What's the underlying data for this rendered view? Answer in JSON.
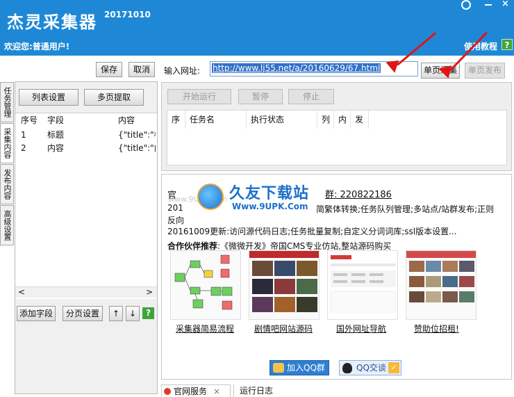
{
  "app": {
    "title": "杰灵采集器",
    "version": "20171010",
    "welcome": "欢迎您:普通用户!",
    "tutorial": "使用教程",
    "help_badge": "?"
  },
  "side_tabs": [
    "任务管理",
    "采集内容",
    "发布内容",
    "高级设置"
  ],
  "toolbar": {
    "save": "保存",
    "cancel": "取消",
    "list_settings": "列表设置",
    "multi_extract": "多页提取"
  },
  "field_table": {
    "headers": [
      "序号",
      "字段",
      "内容"
    ],
    "rows": [
      {
        "no": "1",
        "field": "标题",
        "content": "{\"title\":\"标题\""
      },
      {
        "no": "2",
        "field": "内容",
        "content": "{\"title\":\"内容\""
      }
    ],
    "scroll_left": "<",
    "scroll_right": ">"
  },
  "left_bottom": {
    "add_field": "添加字段",
    "page_settings": "分页设置",
    "up": "↑",
    "down": "↓",
    "help": "?"
  },
  "url_bar": {
    "label": "输入网址:",
    "value": "http://www.lj55.net/a/20160629/67.html",
    "single_collect": "单页采集",
    "single_publish": "单页发布"
  },
  "task_toolbar": {
    "start": "开始运行",
    "pause": "暂停",
    "stop": "停止"
  },
  "task_table": {
    "headers": [
      "序",
      "任务名",
      "执行状态",
      "列",
      "内",
      "发"
    ]
  },
  "browser": {
    "line1_prefix": "官",
    "line1_qq": "群: 220822186",
    "line2a": "201",
    "line2b": "简繁体转换;任务队列管理;多站点/站群发布;正则",
    "line3": "反向",
    "line4": "20161009更新:访问源代码日志;任务批量复制;自定义分词词库;ssl版本设置...",
    "partner_label": "合作伙伴推荐",
    "partner_text": ":《微微开发》帝国CMS专业仿站,整站源码购买",
    "watermark_big": "久友下载站",
    "watermark_small": "Www.9UPK.Com",
    "watermark_left": "www.9UPK.com",
    "thumbs": [
      {
        "label": "采集器简易流程"
      },
      {
        "label": "剧情吧网站源码"
      },
      {
        "label": "国外网址导航"
      },
      {
        "label": "赞助位招租!"
      }
    ],
    "join_qq": "加入QQ群",
    "qq_chat": "QQ交谈"
  },
  "bottom_tabs": {
    "official": "官网服务",
    "log": "运行日志"
  },
  "colors": {
    "title_bar": "#1e88d6",
    "selection": "#3170c8",
    "arrow": "#e01515"
  }
}
